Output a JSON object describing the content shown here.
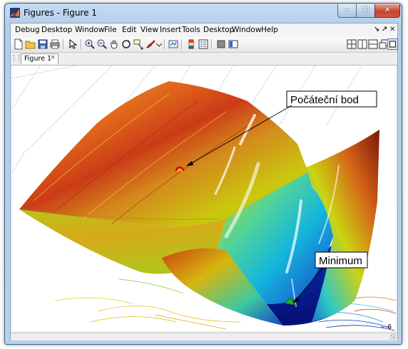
{
  "window": {
    "title": "Figures - Figure 1",
    "controls": {
      "minimize": "–",
      "maximize": "□",
      "close": "✕"
    }
  },
  "menubar": {
    "items": [
      "Debug",
      "Desktop",
      "Window",
      "File",
      "Edit",
      "View",
      "Insert",
      "Tools",
      "Desktop",
      "Window",
      "Help"
    ],
    "right_controls": [
      "↘",
      "↗",
      "✕"
    ]
  },
  "toolbar": {
    "left_icons": [
      "new-figure-icon",
      "open-file-icon",
      "save-icon",
      "print-icon",
      "select-arrow-icon",
      "zoom-in-icon",
      "zoom-out-icon",
      "pan-hand-icon",
      "rotate-3d-icon",
      "data-cursor-icon",
      "brush-icon",
      "link-plot-icon",
      "hide-plot-tools-icon",
      "colorbar-icon",
      "legend-icon"
    ],
    "right_icons": [
      "tile-grid-icon",
      "tile-columns-icon",
      "tile-rows-icon",
      "float-icon",
      "maximize-icon"
    ]
  },
  "doc_tabs": [
    {
      "label": "Figure 1",
      "close": "×"
    }
  ],
  "figure": {
    "annotations": [
      {
        "id": "start",
        "text": "Počáteční bod"
      },
      {
        "id": "min",
        "text": "Minimum"
      }
    ],
    "axis_tick_label": "-6",
    "colors": {
      "surface_high": "#c0391b",
      "surface_mid": "#d8d800",
      "surface_low": "#0a1a8c",
      "start_marker": "#ff0000",
      "min_marker": "#1db31d"
    }
  }
}
